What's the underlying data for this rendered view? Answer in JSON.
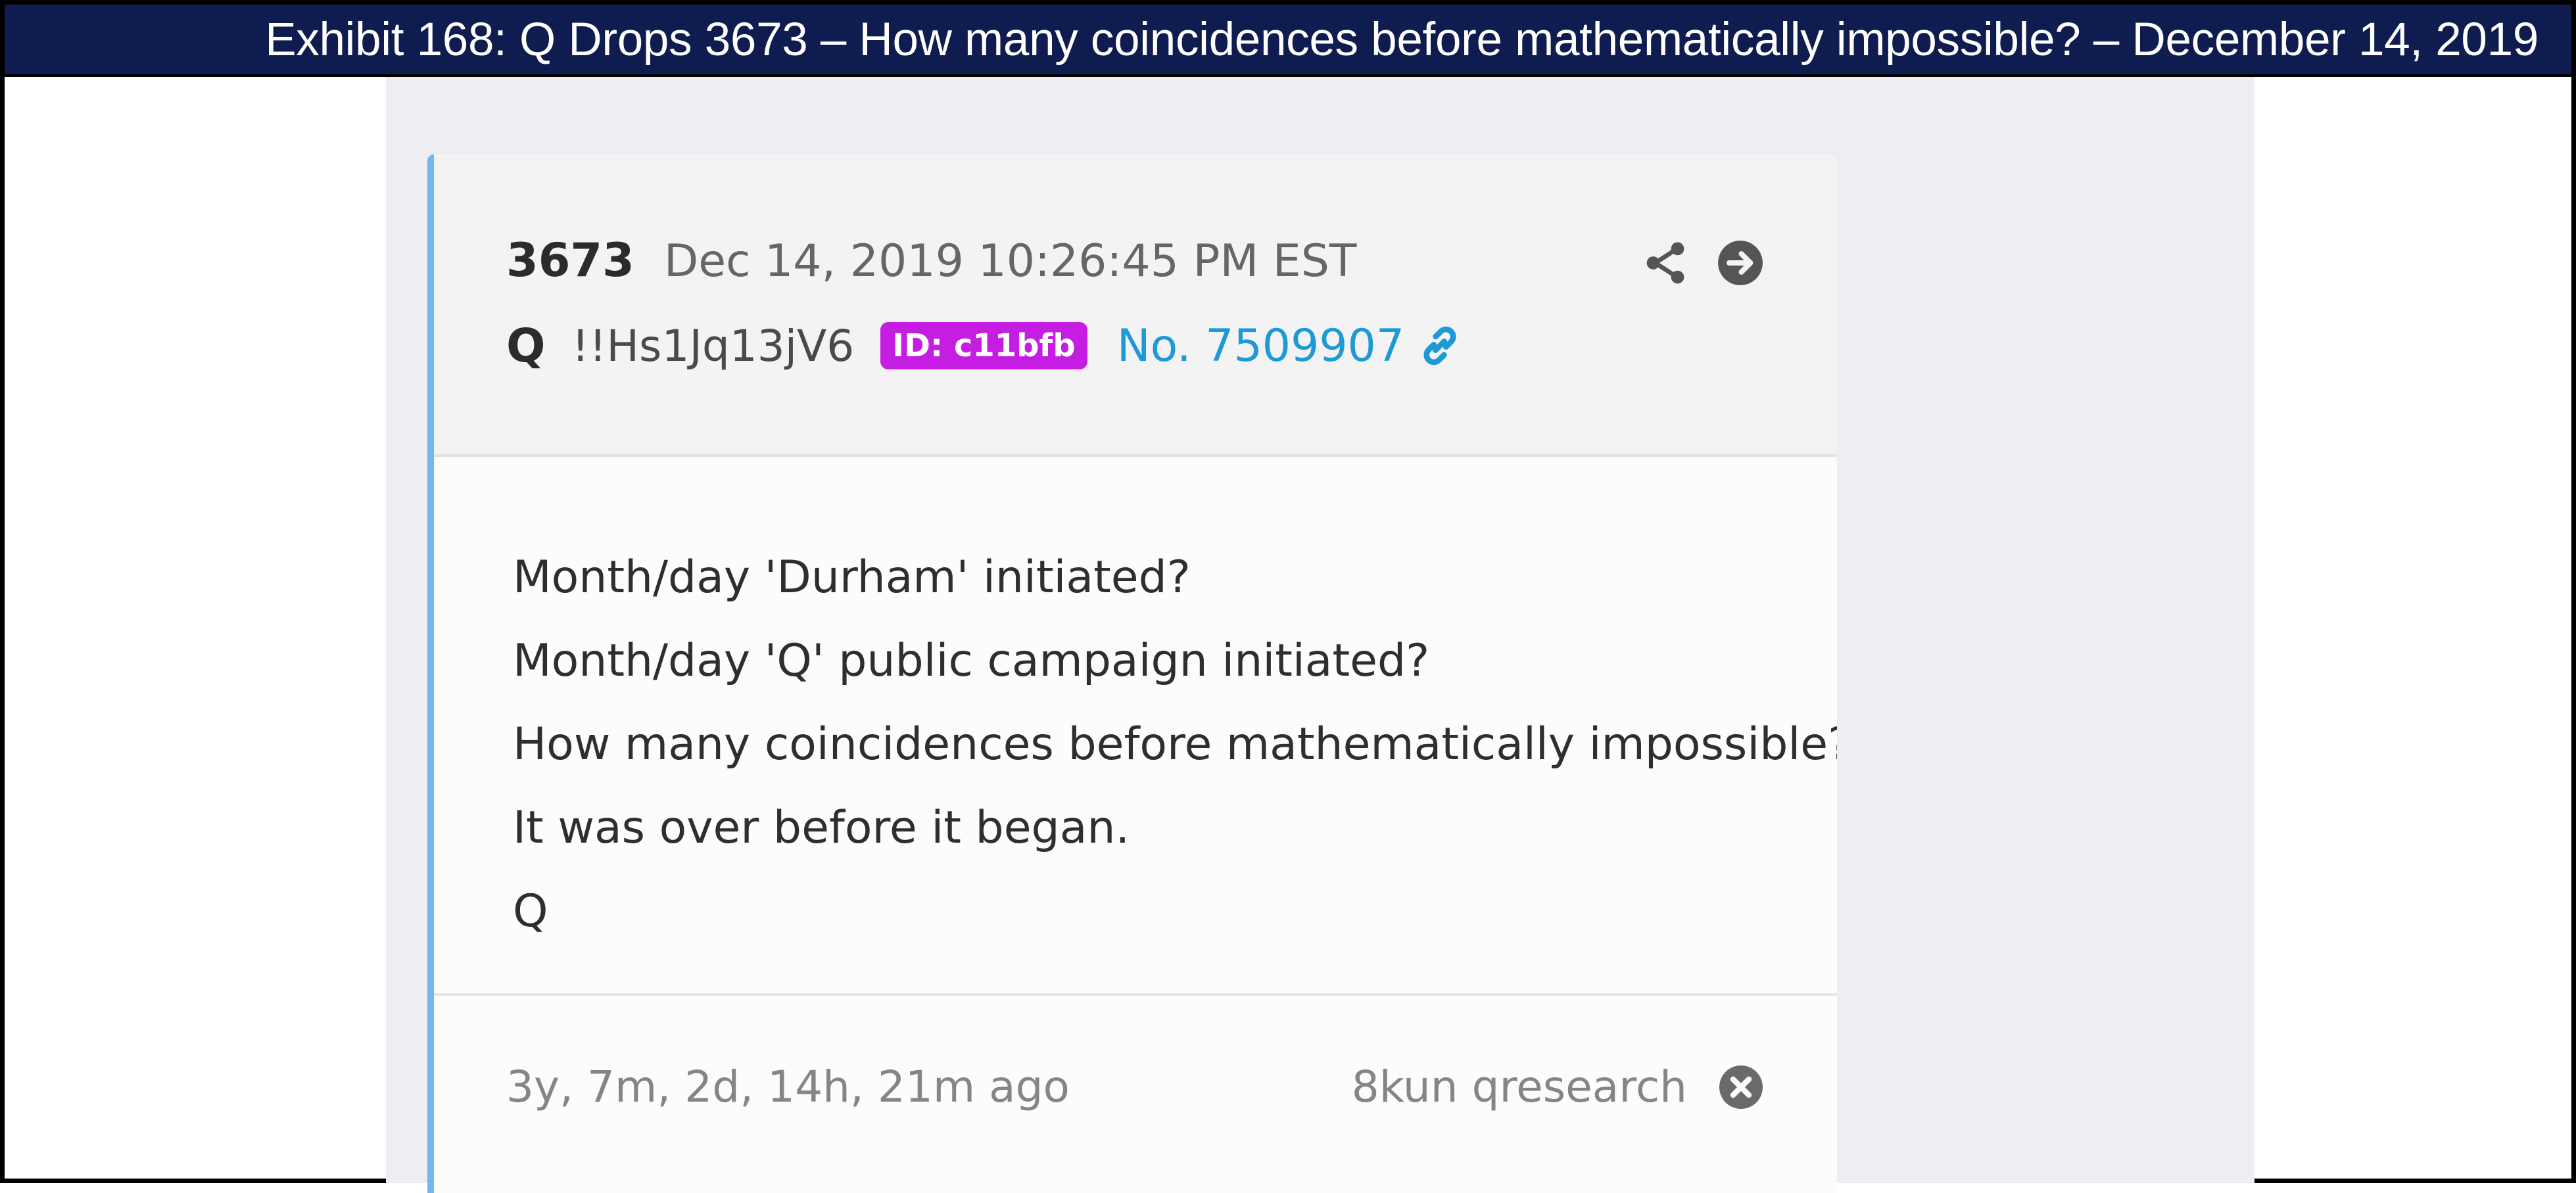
{
  "exhibit_title": "Exhibit 168: Q Drops 3673 – How many coincidences before mathematically impossible? – December 14, 2019",
  "post": {
    "number": "3673",
    "timestamp": "Dec 14, 2019 10:26:45 PM EST",
    "author": "Q",
    "tripcode": "!!Hs1Jq13jV6",
    "id_badge": "ID: c11bfb",
    "post_no": "No. 7509907",
    "body_lines": [
      "Month/day 'Durham' initiated?",
      "Month/day 'Q' public campaign initiated?",
      "How many coincidences before mathematically impossible?",
      "It was over before it began.",
      "Q"
    ],
    "age": "3y, 7m, 2d, 14h, 21m ago",
    "source": "8kun qresearch"
  },
  "icons": {
    "share": "share-icon",
    "open": "arrow-right-circle-icon",
    "link": "link-icon",
    "close": "close-circle-icon"
  },
  "colors": {
    "title_bar": "#0f1c4f",
    "accent_border": "#76b4f2",
    "id_badge": "#c51ee2",
    "post_link": "#1d9ad6"
  }
}
